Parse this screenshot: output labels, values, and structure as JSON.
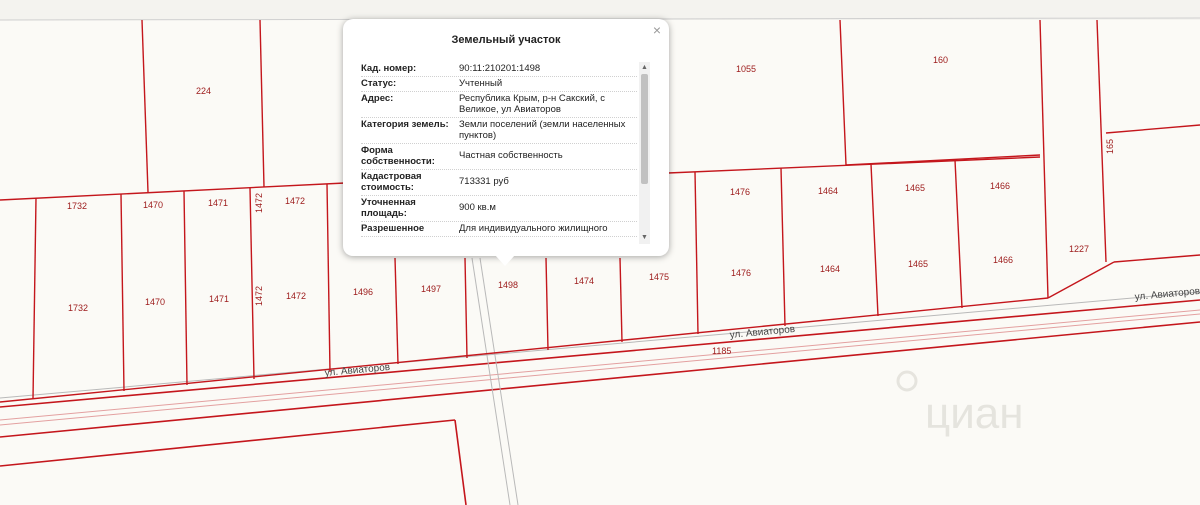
{
  "map": {
    "parcels": [
      {
        "label": "224"
      },
      {
        "label": "1055"
      },
      {
        "label": "160"
      },
      {
        "label": "165"
      },
      {
        "label": "1732"
      },
      {
        "label": "1470"
      },
      {
        "label": "1471"
      },
      {
        "label": "1472"
      },
      {
        "label": "1472"
      },
      {
        "label": "1476"
      },
      {
        "label": "1464"
      },
      {
        "label": "1465"
      },
      {
        "label": "1466"
      },
      {
        "label": "1732"
      },
      {
        "label": "1470"
      },
      {
        "label": "1471"
      },
      {
        "label": "1472"
      },
      {
        "label": "1472"
      },
      {
        "label": "1496"
      },
      {
        "label": "1497"
      },
      {
        "label": "1498"
      },
      {
        "label": "1474"
      },
      {
        "label": "1475"
      },
      {
        "label": "1476"
      },
      {
        "label": "1464"
      },
      {
        "label": "1465"
      },
      {
        "label": "1466"
      },
      {
        "label": "1227"
      },
      {
        "label": "1185"
      }
    ],
    "streets": [
      {
        "label": "ул. Авиаторов"
      },
      {
        "label": "ул. Авиаторов"
      },
      {
        "label": "ул. Авиаторов"
      }
    ],
    "watermark": "циан"
  },
  "popup": {
    "title": "Земельный участок",
    "close": "×",
    "rows": [
      {
        "key": "Кад. номер:",
        "value": "90:11:210201:1498"
      },
      {
        "key": "Статус:",
        "value": "Учтенный"
      },
      {
        "key": "Адрес:",
        "value": "Республика Крым, р-н Сакский, с Великое, ул Авиаторов"
      },
      {
        "key": "Категория земель:",
        "value": "Земли поселений (земли населенных пунктов)"
      },
      {
        "key": "Форма собственности:",
        "value": "Частная собственность"
      },
      {
        "key": "Кадастровая стоимость:",
        "value": "713331 руб"
      },
      {
        "key": "Уточненная площадь:",
        "value": "900 кв.м"
      },
      {
        "key": "Разрешенное",
        "value": "Для индивидуального жилищного"
      }
    ],
    "scroll_up": "▲",
    "scroll_down": "▼"
  },
  "colors": {
    "parcel_line": "#c4161c",
    "road_line": "#e07a7a",
    "gray_line": "#b9b9b9",
    "background": "#fbfaf6"
  }
}
